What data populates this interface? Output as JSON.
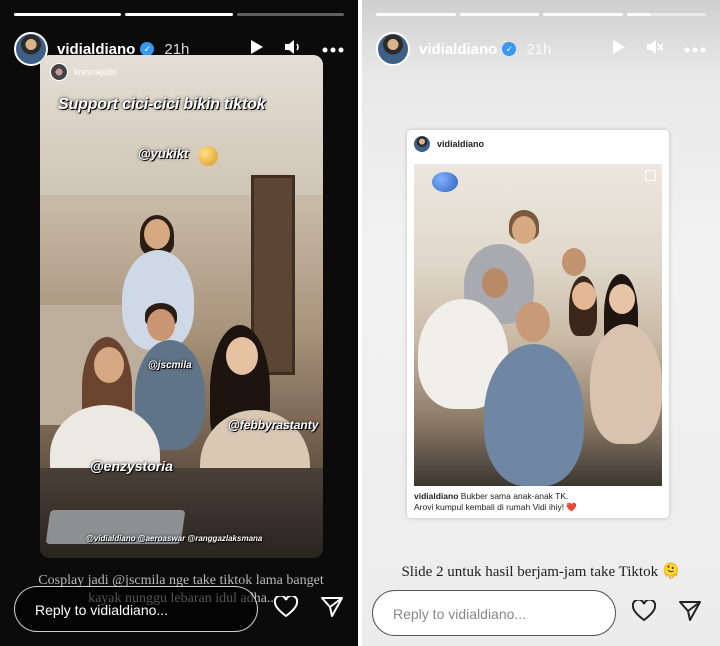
{
  "stories": {
    "left": {
      "progress": [
        1,
        1,
        0
      ],
      "username": "vidialdiano",
      "time": "21h",
      "repost_username": "kresnajulio",
      "sticker_title": "Support cici-cici bikin tiktok",
      "tags": [
        "@yukikt",
        "@jscmila",
        "@febbyrastanty",
        "@enzystoria",
        "@vidialdiano @aeroaswar @ranggazlaksmana"
      ],
      "caption": "Cosplay jadi @jscmila nge take tiktok lama banget kayak nunggu lebaran idul adha..",
      "reply_placeholder": "Reply to vidialdiano..."
    },
    "right": {
      "progress": [
        1,
        1,
        1,
        0.3
      ],
      "username": "vidialdiano",
      "time": "21h",
      "post": {
        "username": "vidialdiano",
        "caption_user": "vidialdiano",
        "caption_line1": "Bukber sama anak-anak TK.",
        "caption_line2": "Arovi kumpul kembali di rumah Vidi ihiy! ❤️"
      },
      "caption": "Slide 2 untuk hasil berjam-jam take Tiktok 🫠",
      "reply_placeholder": "Reply to vidialdiano..."
    }
  },
  "icons": {
    "play": "play-icon",
    "sound_on": "sound-on-icon",
    "sound_off": "sound-off-icon",
    "more": "more-icon",
    "heart": "heart-icon",
    "send": "send-icon",
    "verified": "verified-badge-icon"
  },
  "colors": {
    "verified": "#3897f0",
    "left_bg": "#0b0b0b",
    "right_bg": "#ececec"
  }
}
